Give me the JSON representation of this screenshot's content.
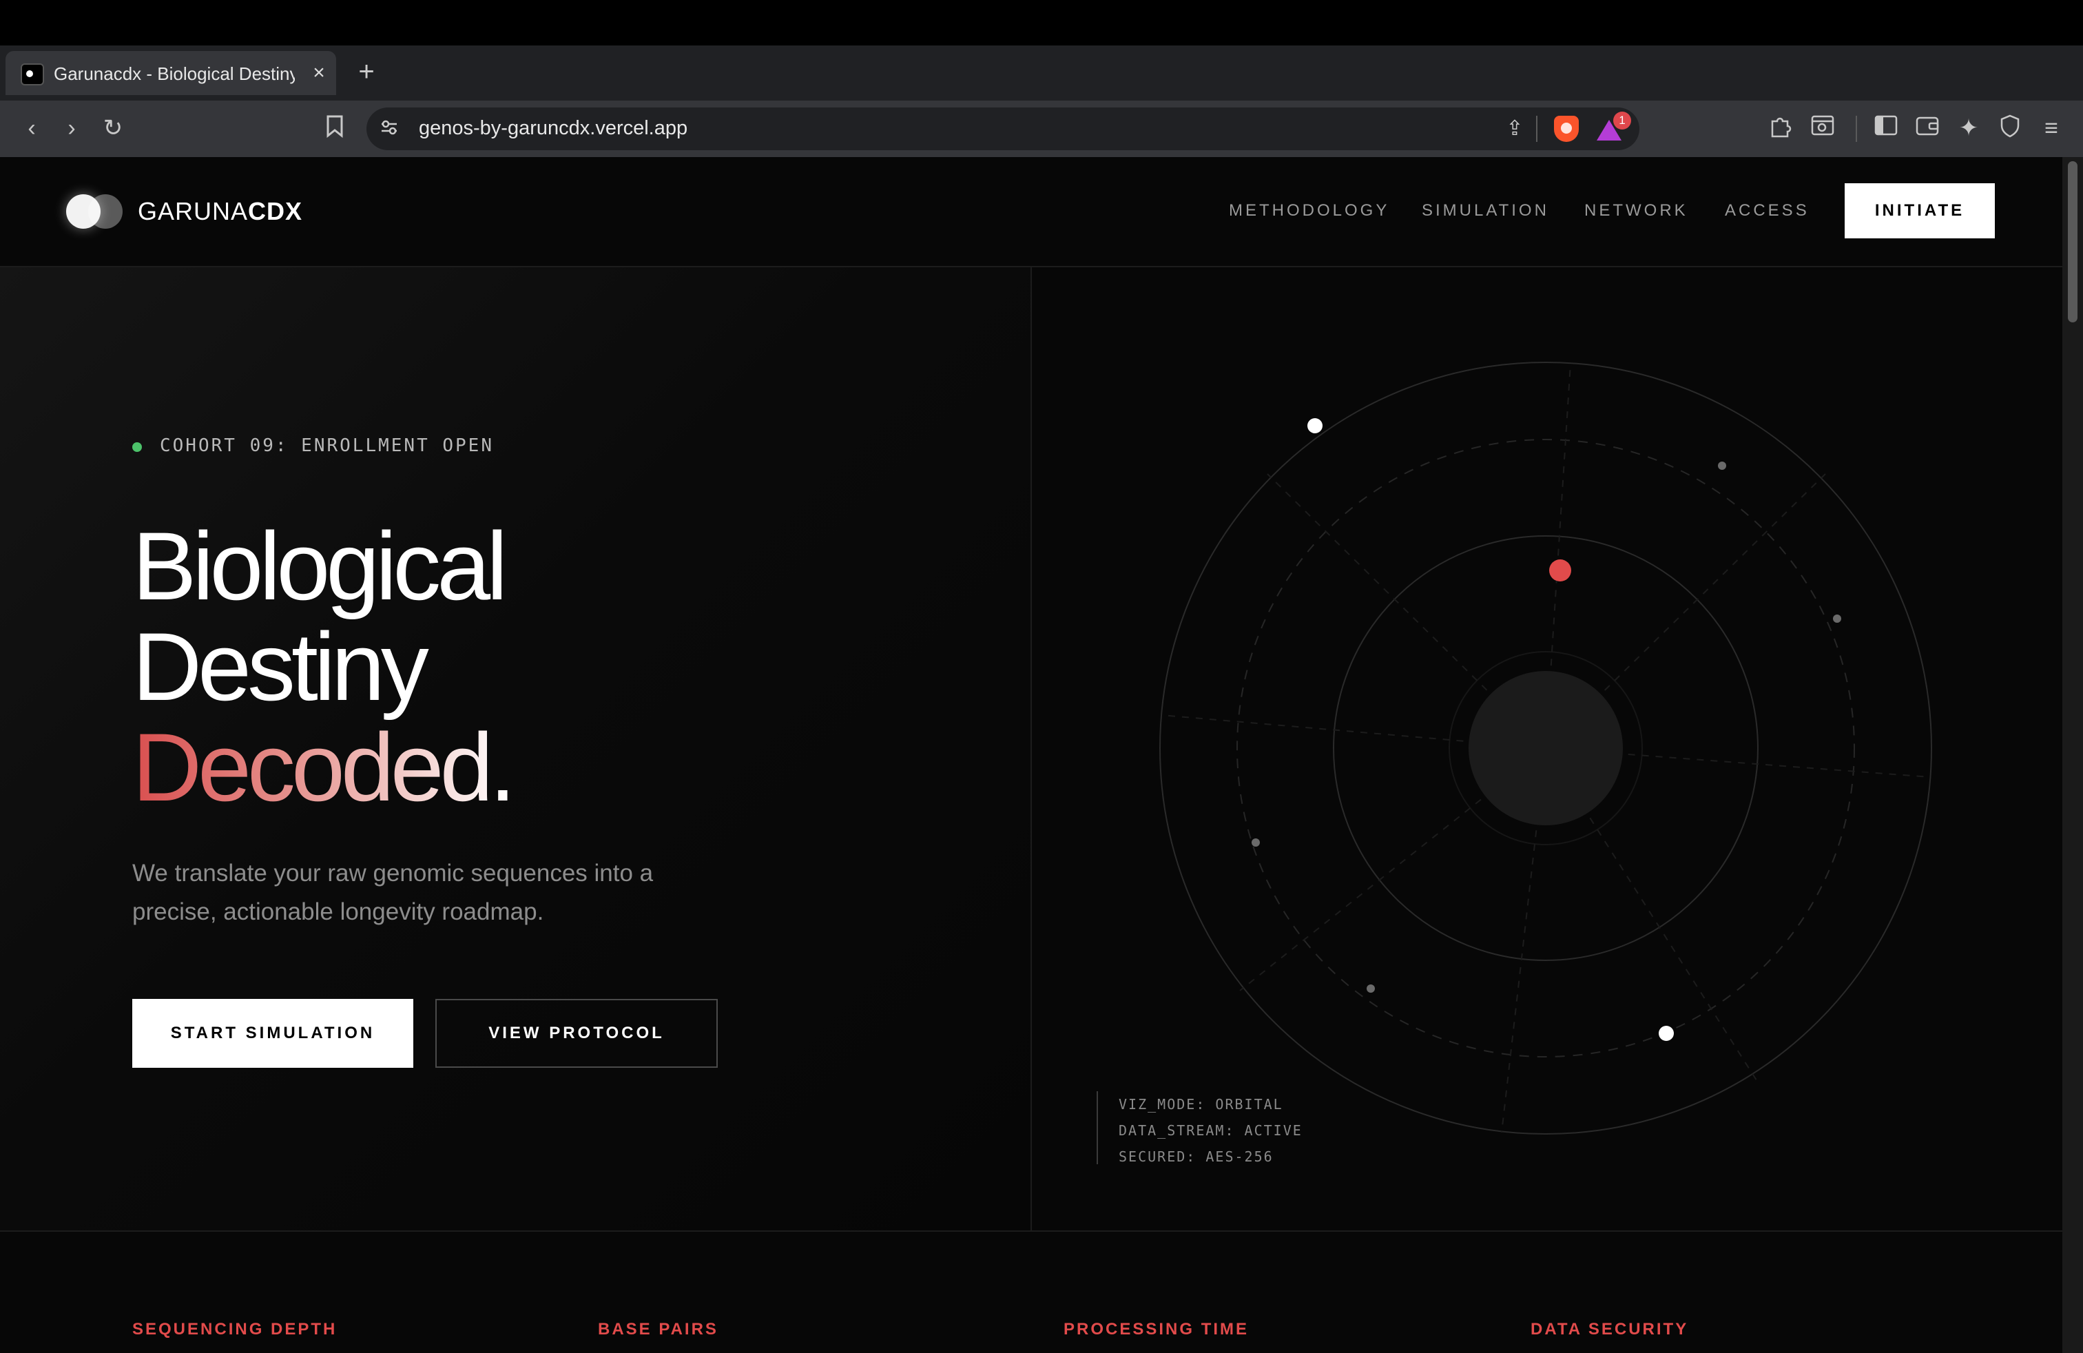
{
  "browser": {
    "tab_title": "Garunacdx - Biological Destiny",
    "url": "genos-by-garuncdx.vercel.app",
    "rewards_badge": "1"
  },
  "nav": {
    "logo_light": "GARUNA",
    "logo_bold": "CDX",
    "links": [
      "METHODOLOGY",
      "SIMULATION",
      "NETWORK",
      "ACCESS"
    ],
    "cta": "INITIATE"
  },
  "hero": {
    "status": "COHORT 09: ENROLLMENT OPEN",
    "title_line1": "Biological",
    "title_line2": "Destiny",
    "title_line3": "Decoded.",
    "lead": "We translate your raw genomic sequences into a precise, actionable longevity roadmap.",
    "primary_button": "START SIMULATION",
    "secondary_button": "VIEW PROTOCOL"
  },
  "viz": {
    "readout": [
      "VIZ_MODE: ORBITAL",
      "DATA_STREAM: ACTIVE",
      "SECURED: AES-256"
    ],
    "accent_color": "#e24b4b"
  },
  "stats": {
    "labels": [
      "SEQUENCING DEPTH",
      "BASE PAIRS",
      "PROCESSING TIME",
      "DATA SECURITY"
    ]
  }
}
